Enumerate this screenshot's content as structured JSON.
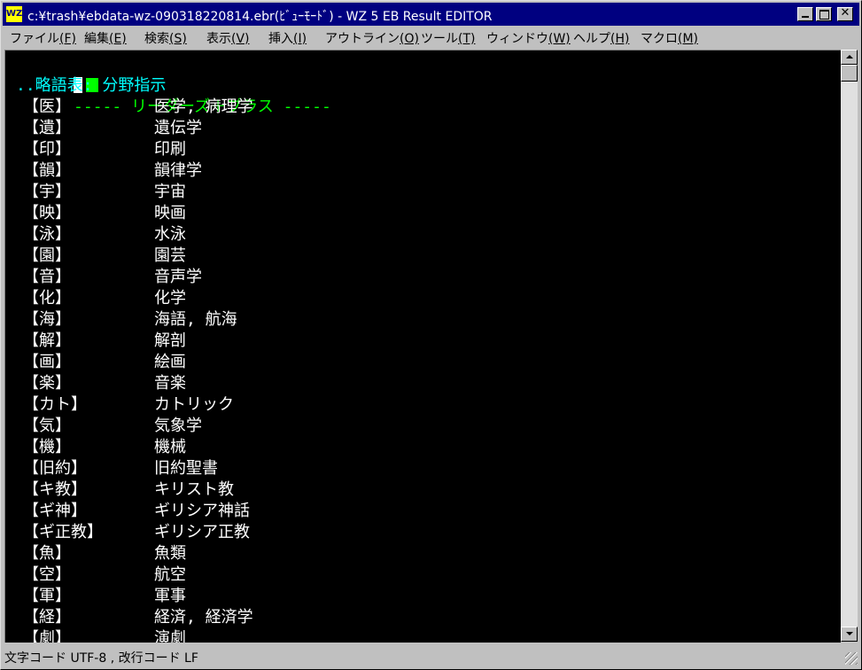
{
  "window": {
    "title": "c:¥trash¥ebdata-wz-090318220814.ebr(ﾋﾞｭｰﾓｰﾄﾞ) - WZ 5 EB Result EDITOR",
    "app_icon_label": "WZ"
  },
  "menu": [
    {
      "label": "ファイル",
      "key": "(F)"
    },
    {
      "label": "編集",
      "key": "(E)"
    },
    {
      "label": "検索",
      "key": "(S)"
    },
    {
      "label": "表示",
      "key": "(V)"
    },
    {
      "label": "挿入",
      "key": "(I)"
    },
    {
      "label": "アウトライン",
      "key": "(O)"
    },
    {
      "label": "ツール",
      "key": "(T)"
    },
    {
      "label": "ウィンドウ",
      "key": "(W)"
    },
    {
      "label": "ヘルプ",
      "key": "(H)"
    },
    {
      "label": "マクロ",
      "key": "(M)"
    }
  ],
  "editor": {
    "header_line": "----- リーダーズ＋プラス -----",
    "subheader_line": "..略語表: 分野指示",
    "rows": [
      {
        "code": "【医】",
        "term": "医学, 病理学"
      },
      {
        "code": "【遺】",
        "term": "遺伝学"
      },
      {
        "code": "【印】",
        "term": "印刷"
      },
      {
        "code": "【韻】",
        "term": "韻律学"
      },
      {
        "code": "【宇】",
        "term": "宇宙"
      },
      {
        "code": "【映】",
        "term": "映画"
      },
      {
        "code": "【泳】",
        "term": "水泳"
      },
      {
        "code": "【園】",
        "term": "園芸"
      },
      {
        "code": "【音】",
        "term": "音声学"
      },
      {
        "code": "【化】",
        "term": "化学"
      },
      {
        "code": "【海】",
        "term": "海語, 航海"
      },
      {
        "code": "【解】",
        "term": "解剖"
      },
      {
        "code": "【画】",
        "term": "絵画"
      },
      {
        "code": "【楽】",
        "term": "音楽"
      },
      {
        "code": "【カト】",
        "term": "カトリック"
      },
      {
        "code": "【気】",
        "term": "気象学"
      },
      {
        "code": "【機】",
        "term": "機械"
      },
      {
        "code": "【旧約】",
        "term": "旧約聖書"
      },
      {
        "code": "【キ教】",
        "term": "キリスト教"
      },
      {
        "code": "【ギ神】",
        "term": "ギリシア神話"
      },
      {
        "code": "【ギ正教】",
        "term": "ギリシア正教"
      },
      {
        "code": "【魚】",
        "term": "魚類"
      },
      {
        "code": "【空】",
        "term": "航空"
      },
      {
        "code": "【軍】",
        "term": "軍事"
      },
      {
        "code": "【経】",
        "term": "経済, 経済学"
      },
      {
        "code": "【劇】",
        "term": "演劇"
      }
    ]
  },
  "status": {
    "text": "文字コード UTF-8 , 改行コード LF"
  }
}
